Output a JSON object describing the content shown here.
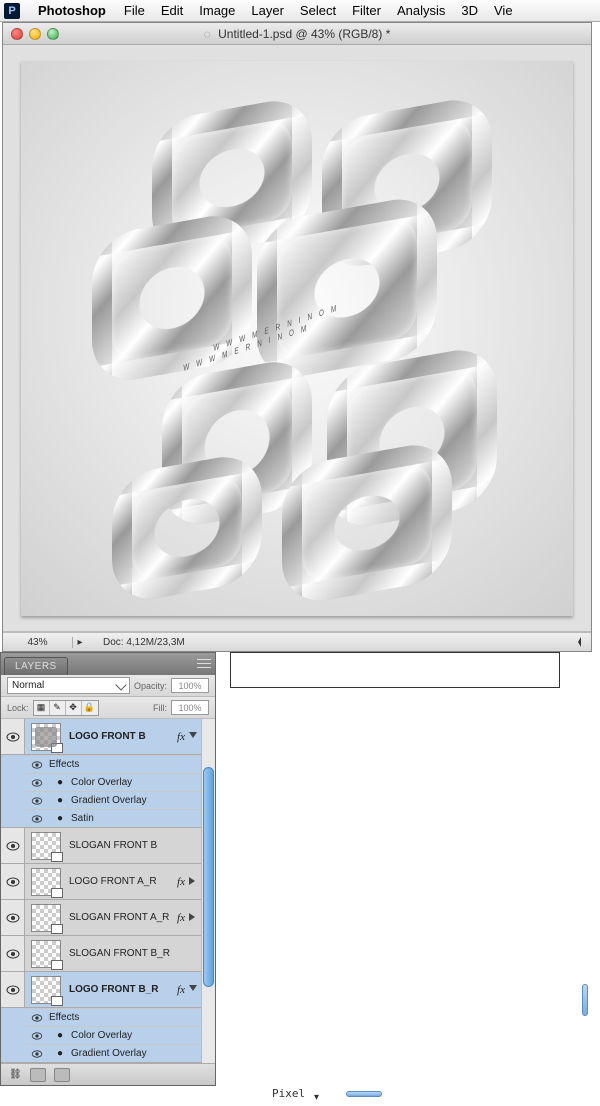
{
  "menubar": {
    "app": "Photoshop",
    "items": [
      "File",
      "Edit",
      "Image",
      "Layer",
      "Select",
      "Filter",
      "Analysis",
      "3D",
      "Vie"
    ]
  },
  "document": {
    "title_prefix": "Untitled-1.psd @ 43% (RGB/8) *",
    "statusbar": {
      "zoom": "43%",
      "doc": "Doc: 4,12M/23,3M"
    }
  },
  "layers_panel": {
    "tab": "LAYERS",
    "blend_mode": "Normal",
    "opacity_label": "Opacity:",
    "opacity_value": "100%",
    "lock_label": "Lock:",
    "fill_label": "Fill:",
    "fill_value": "100%",
    "fx_label": "fx",
    "effects_label": "Effects",
    "effect_color_overlay": "Color Overlay",
    "effect_gradient_overlay": "Gradient Overlay",
    "effect_satin": "Satin",
    "layers": [
      {
        "name": "LOGO FRONT B",
        "selected": true,
        "fx": true,
        "expanded": true,
        "effects": [
          "Color Overlay",
          "Gradient Overlay",
          "Satin"
        ]
      },
      {
        "name": "SLOGAN FRONT B",
        "selected": false,
        "fx": false
      },
      {
        "name": "LOGO FRONT A_R",
        "selected": false,
        "fx": true
      },
      {
        "name": "SLOGAN FRONT A_R",
        "selected": false,
        "fx": true
      },
      {
        "name": "SLOGAN FRONT B_R",
        "selected": false,
        "fx": false
      },
      {
        "name": "LOGO FRONT B_R",
        "selected": true,
        "fx": true,
        "expanded": true,
        "effects": [
          "Color Overlay",
          "Gradient Overlay"
        ]
      }
    ]
  },
  "bottom": {
    "unit_label": "Pixel"
  }
}
